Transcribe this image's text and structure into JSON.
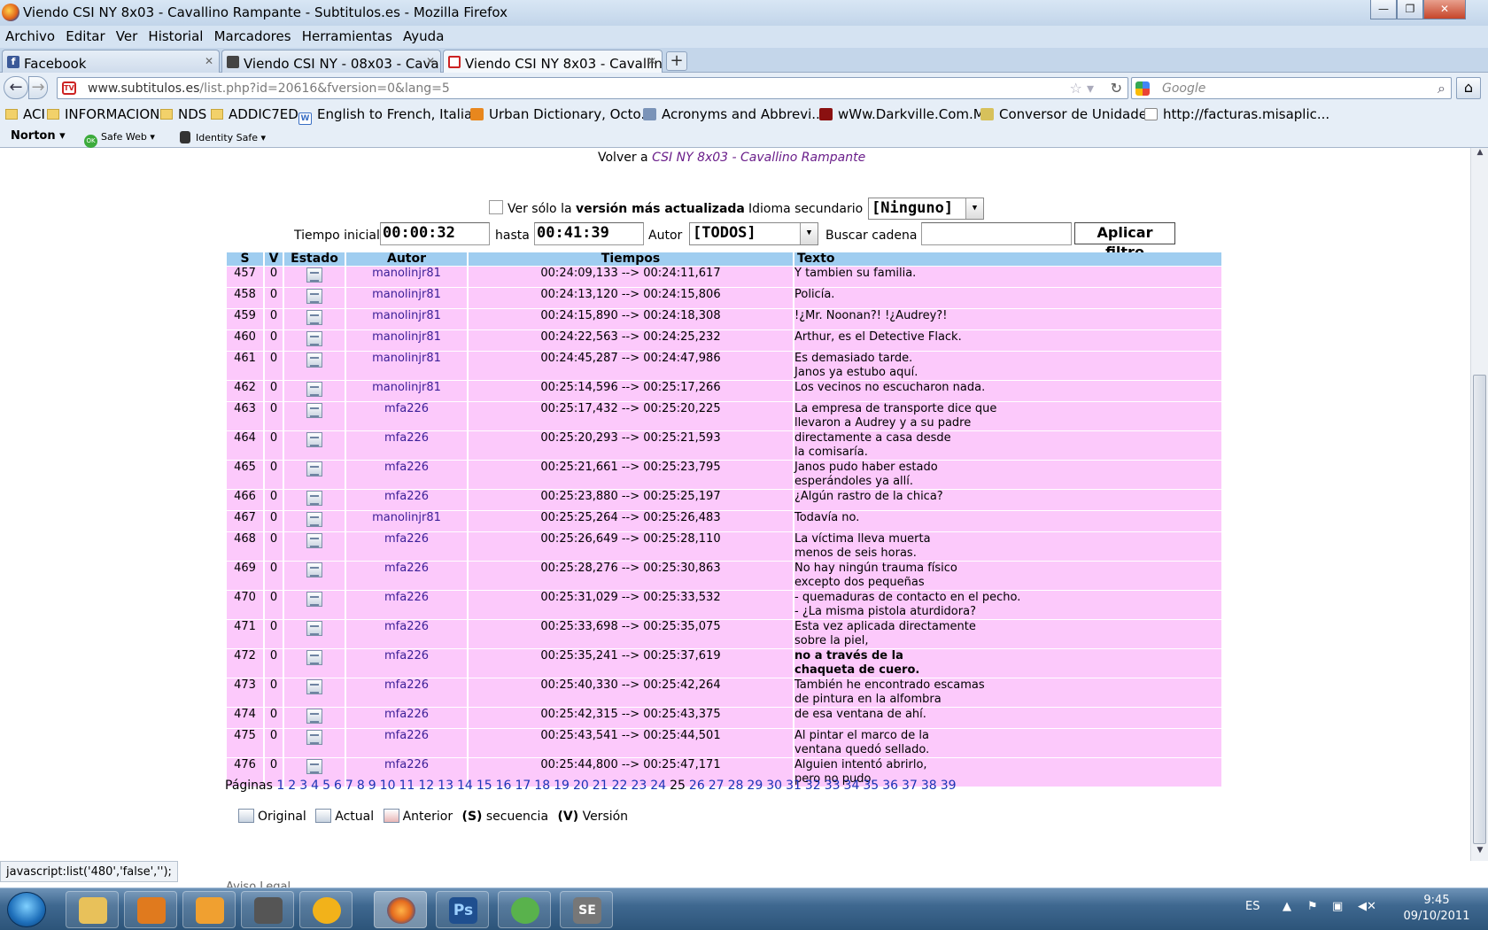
{
  "window": {
    "title": "Viendo CSI NY 8x03 - Cavallino Rampante - Subtitulos.es - Mozilla Firefox",
    "minimize": "—",
    "maximize": "❐",
    "close": "✕"
  },
  "menu": [
    "Archivo",
    "Editar",
    "Ver",
    "Historial",
    "Marcadores",
    "Herramientas",
    "Ayuda"
  ],
  "tabs": [
    {
      "label": "Facebook",
      "icon": "facebook-icon",
      "color": "#3b5998"
    },
    {
      "label": "Viendo CSI NY - 08x03 - Cava...",
      "icon": "video-icon",
      "color": "#333333"
    },
    {
      "label": "Viendo CSI NY 8x03 - Cavallin...",
      "icon": "tv-icon",
      "color": "#cc2222"
    }
  ],
  "nav": {
    "url_host": "www.subtitulos.es",
    "url_path": "/list.php?id=20616&fversion=0&lang=5",
    "search_placeholder": "Google"
  },
  "bookmarks": [
    {
      "label": "ACI",
      "icon": "folder-icon"
    },
    {
      "label": "INFORMACION",
      "icon": "folder-icon"
    },
    {
      "label": "NDS",
      "icon": "folder-icon"
    },
    {
      "label": "ADDIC7ED",
      "icon": "folder-icon"
    },
    {
      "label": "English to French, Italia...",
      "icon": "wordreference-icon"
    },
    {
      "label": "Urban Dictionary, Octo...",
      "icon": "urbandictionary-icon"
    },
    {
      "label": "Acronyms and Abbrevi...",
      "icon": "acronym-icon"
    },
    {
      "label": "wWw.Darkville.Com.Mx",
      "icon": "darkville-icon"
    },
    {
      "label": "Conversor de Unidades",
      "icon": "converter-icon"
    },
    {
      "label": "http://facturas.misaplic...",
      "icon": "page-icon"
    }
  ],
  "norton": {
    "brand": "Norton",
    "safeweb": "Safe Web",
    "ok": "OK",
    "identity": "Identity Safe"
  },
  "page": {
    "volver_prefix": "Volver a",
    "volver_link": "CSI NY 8x03 - Cavallino Rampante",
    "filter": {
      "checkbox_pre": "Ver sólo la",
      "checkbox_bold": "versión más actualizada",
      "idioma_label": "Idioma secundario",
      "idioma_value": "[Ninguno]",
      "tiempo_label": "Tiempo inicial",
      "tiempo_value": "00:00:32",
      "hasta_label": "hasta",
      "hasta_value": "00:41:39",
      "autor_label": "Autor",
      "autor_value": "[TODOS]",
      "buscar_label": "Buscar cadena",
      "buscar_value": "",
      "apply": "Aplicar filtro"
    },
    "columns": [
      "S",
      "V",
      "Estado",
      "Autor",
      "Tiempos",
      "Texto"
    ],
    "rows": [
      {
        "s": "457",
        "v": "0",
        "autor": "manolinjr81",
        "t": "00:24:09,133 --> 00:24:11,617",
        "text": [
          "Y tambien su familia."
        ]
      },
      {
        "s": "458",
        "v": "0",
        "autor": "manolinjr81",
        "t": "00:24:13,120 --> 00:24:15,806",
        "text": [
          "Policía."
        ]
      },
      {
        "s": "459",
        "v": "0",
        "autor": "manolinjr81",
        "t": "00:24:15,890 --> 00:24:18,308",
        "text": [
          "!¿Mr. Noonan?! !¿Audrey?!"
        ]
      },
      {
        "s": "460",
        "v": "0",
        "autor": "manolinjr81",
        "t": "00:24:22,563 --> 00:24:25,232",
        "text": [
          "Arthur, es el Detective Flack."
        ]
      },
      {
        "s": "461",
        "v": "0",
        "autor": "manolinjr81",
        "t": "00:24:45,287 --> 00:24:47,986",
        "text": [
          "Es demasiado tarde.",
          "Janos ya estubo aquí."
        ]
      },
      {
        "s": "462",
        "v": "0",
        "autor": "manolinjr81",
        "t": "00:25:14,596 --> 00:25:17,266",
        "text": [
          "Los vecinos no escucharon nada."
        ]
      },
      {
        "s": "463",
        "v": "0",
        "autor": "mfa226",
        "t": "00:25:17,432 --> 00:25:20,225",
        "text": [
          "La empresa de transporte dice que",
          "llevaron a Audrey y a su padre"
        ]
      },
      {
        "s": "464",
        "v": "0",
        "autor": "mfa226",
        "t": "00:25:20,293 --> 00:25:21,593",
        "text": [
          "directamente a casa desde",
          "la comisaría."
        ]
      },
      {
        "s": "465",
        "v": "0",
        "autor": "mfa226",
        "t": "00:25:21,661 --> 00:25:23,795",
        "text": [
          "Janos pudo haber estado",
          "esperándoles ya allí."
        ]
      },
      {
        "s": "466",
        "v": "0",
        "autor": "mfa226",
        "t": "00:25:23,880 --> 00:25:25,197",
        "text": [
          "¿Algún rastro de la chica?"
        ]
      },
      {
        "s": "467",
        "v": "0",
        "autor": "manolinjr81",
        "t": "00:25:25,264 --> 00:25:26,483",
        "text": [
          "Todavía no."
        ]
      },
      {
        "s": "468",
        "v": "0",
        "autor": "mfa226",
        "t": "00:25:26,649 --> 00:25:28,110",
        "text": [
          "La víctima lleva muerta",
          "menos de seis horas."
        ]
      },
      {
        "s": "469",
        "v": "0",
        "autor": "mfa226",
        "t": "00:25:28,276 --> 00:25:30,863",
        "text": [
          "No hay ningún trauma físico",
          "excepto dos pequeñas"
        ]
      },
      {
        "s": "470",
        "v": "0",
        "autor": "mfa226",
        "t": "00:25:31,029 --> 00:25:33,532",
        "text": [
          "- quemaduras de contacto en el pecho.",
          "- ¿La misma pistola aturdidora?"
        ]
      },
      {
        "s": "471",
        "v": "0",
        "autor": "mfa226",
        "t": "00:25:33,698 --> 00:25:35,075",
        "text": [
          "Esta vez aplicada directamente",
          "sobre la piel,"
        ]
      },
      {
        "s": "472",
        "v": "0",
        "autor": "mfa226",
        "t": "00:25:35,241 --> 00:25:37,619",
        "text": [
          "no a través de la",
          "chaqueta de cuero."
        ],
        "bold": true
      },
      {
        "s": "473",
        "v": "0",
        "autor": "mfa226",
        "t": "00:25:40,330 --> 00:25:42,264",
        "text": [
          "También he encontrado escamas",
          "de pintura en la alfombra"
        ]
      },
      {
        "s": "474",
        "v": "0",
        "autor": "mfa226",
        "t": "00:25:42,315 --> 00:25:43,375",
        "text": [
          "de esa ventana de ahí."
        ]
      },
      {
        "s": "475",
        "v": "0",
        "autor": "mfa226",
        "t": "00:25:43,541 --> 00:25:44,501",
        "text": [
          "Al pintar el marco de la",
          "ventana quedó sellado."
        ]
      },
      {
        "s": "476",
        "v": "0",
        "autor": "mfa226",
        "t": "00:25:44,800 --> 00:25:47,171",
        "text": [
          "Alguien intentó abrirlo,",
          "pero no pudo."
        ]
      }
    ],
    "pages_label": "Páginas",
    "pages": [
      "1",
      "2",
      "3",
      "4",
      "5",
      "6",
      "7",
      "8",
      "9",
      "10",
      "11",
      "12",
      "13",
      "14",
      "15",
      "16",
      "17",
      "18",
      "19",
      "20",
      "21",
      "22",
      "23",
      "24",
      "25",
      "26",
      "27",
      "28",
      "29",
      "30",
      "31",
      "32",
      "33",
      "34",
      "35",
      "36",
      "37",
      "38",
      "39"
    ],
    "current_page": "25",
    "legend": {
      "original": "Original",
      "actual": "Actual",
      "anterior": "Anterior",
      "s_key": "(S)",
      "s_text": "secuencia",
      "v_key": "(V)",
      "v_text": "Versión"
    },
    "aviso": "Aviso Legal"
  },
  "status": "javascript:list('480','false','');",
  "taskbar": {
    "apps": [
      {
        "name": "explorer",
        "color": "#e8c15a"
      },
      {
        "name": "media-player",
        "color": "#e07a1e"
      },
      {
        "name": "outlook",
        "color": "#f0a030"
      },
      {
        "name": "movie-maker",
        "color": "#555555"
      },
      {
        "name": "winamp",
        "color": "#f2b21a"
      },
      {
        "name": "firefox",
        "color": "#e46a1e"
      },
      {
        "name": "photoshop",
        "color": "#1f4f8f"
      },
      {
        "name": "messenger",
        "color": "#59b24c"
      },
      {
        "name": "se-app",
        "color": "#777777"
      }
    ],
    "lang": "ES",
    "time": "9:45",
    "date": "09/10/2011"
  },
  "colors": {
    "header_blue": "#9fcdf0",
    "row_pink": "#fcc9fb",
    "author_link": "#3b1f97",
    "page_link": "#1b34b5",
    "volver_link": "#6a1e8a"
  }
}
